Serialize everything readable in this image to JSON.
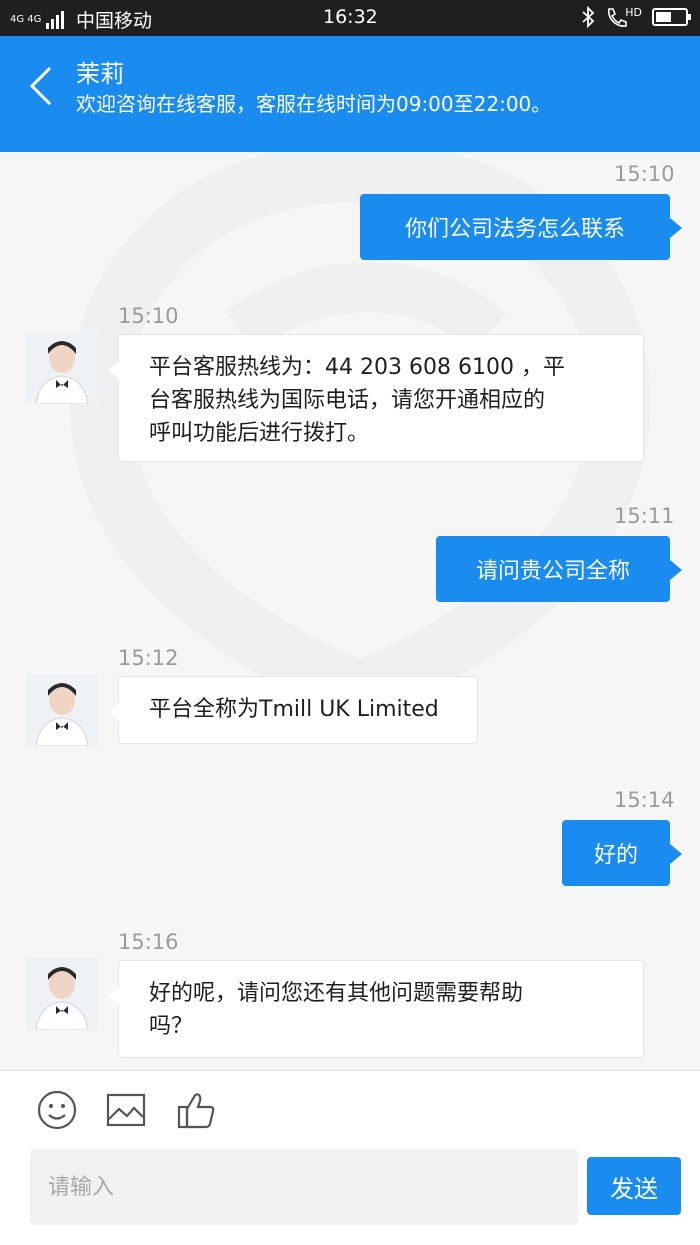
{
  "status_bar": {
    "network": "4G 4G",
    "carrier": "中国移动",
    "time": "16:32",
    "hd": "HD",
    "battery_level": 0.55
  },
  "header": {
    "name": "茉莉",
    "subtitle": "欢迎咨询在线客服，客服在线时间为09:00至22:00。"
  },
  "messages": [
    {
      "side": "right",
      "time": "15:10",
      "text": "你们公司法务怎么联系"
    },
    {
      "side": "left",
      "time": "15:10",
      "lines": [
        "平台客服热线为：44 203 608 6100 ，平",
        "台客服热线为国际电话，请您开通相应的",
        "呼叫功能后进行拨打。"
      ]
    },
    {
      "side": "right",
      "time": "15:11",
      "text": "请问贵公司全称"
    },
    {
      "side": "left",
      "time": "15:12",
      "lines": [
        "平台全称为Tmill UK Limited"
      ]
    },
    {
      "side": "right",
      "time": "15:14",
      "text": "好的"
    },
    {
      "side": "left",
      "time": "15:16",
      "lines": [
        "好的呢，请问您还有其他问题需要帮助",
        "吗？"
      ]
    }
  ],
  "composer": {
    "placeholder": "请输入",
    "value": "",
    "send_label": "发送",
    "tools": [
      "emoji-icon",
      "image-icon",
      "thumbs-up-icon"
    ]
  },
  "colors": {
    "accent": "#1a8cf0",
    "status_bar": "#1f1f1f",
    "background": "#f6f6f6"
  }
}
